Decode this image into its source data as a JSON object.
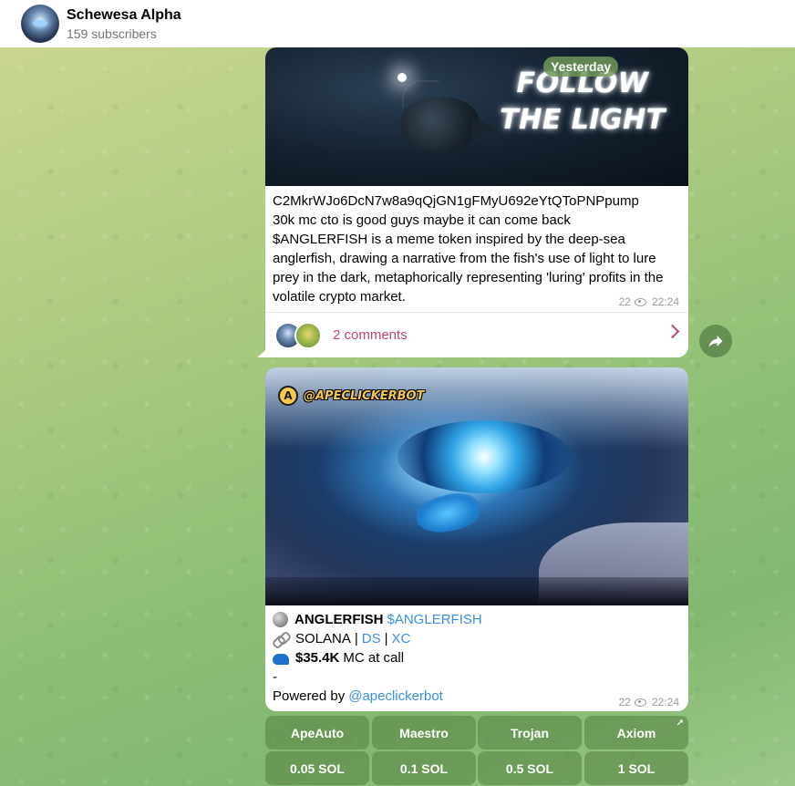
{
  "channel": {
    "title": "Schewesa Alpha",
    "subscribers": "159 subscribers"
  },
  "date_pill": "Yesterday",
  "message1": {
    "image_text": "FOLLOW THE LIGHT",
    "lines": [
      "C2MkrWJo6DcN7w8a9qQjGN1gFMyU692eYtQToPNPpump",
      "30k mc cto is good guys maybe it can come back",
      "$ANGLERFISH is a meme token inspired by the deep-sea anglerfish, drawing a narrative from the fish's use of light to lure prey in the dark, metaphorically representing 'luring' profits in the volatile crypto market."
    ],
    "views": "22",
    "time": "22:24",
    "comments_label": "2 comments"
  },
  "message2": {
    "image_badge": "@APECLICKERBOT",
    "image_badge_icon": "A",
    "token_name": "ANGLERFISH",
    "token_ticker": "$ANGLERFISH",
    "chain": "SOLANA",
    "sep1": "|",
    "ds_link": "DS",
    "sep2": "|",
    "xc_link": "XC",
    "mc_value": "$35.4K",
    "mc_text": "MC at call",
    "dash": "-",
    "powered_by": "Powered by",
    "powered_link": "@apeclickerbot",
    "views": "22",
    "time": "22:24"
  },
  "keyboard": {
    "row1": [
      "ApeAuto",
      "Maestro",
      "Trojan",
      "Axiom"
    ],
    "row2": [
      "0.05 SOL",
      "0.1 SOL",
      "0.5 SOL",
      "1 SOL"
    ],
    "axiom_arrow": "↗"
  },
  "icons": [
    "avatar",
    "eye-icon",
    "chevron-right-icon",
    "share-icon",
    "moon-emoji",
    "link-emoji",
    "cap-emoji",
    "external-link-icon"
  ]
}
